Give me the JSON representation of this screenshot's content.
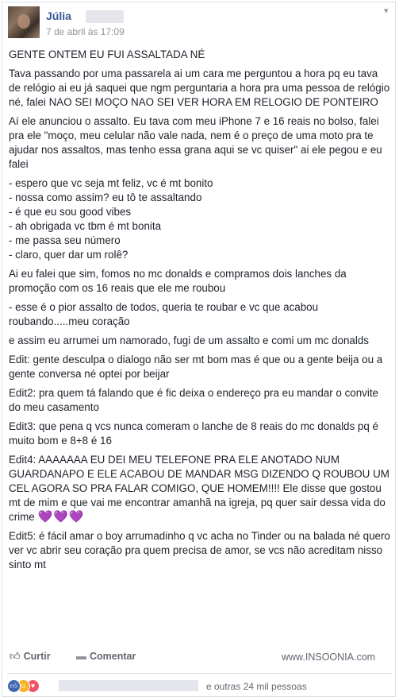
{
  "post": {
    "author": "Júlia",
    "timestamp": "7 de abril às 17:09",
    "paragraphs": {
      "p1": "GENTE ONTEM EU FUI ASSALTADA NÉ",
      "p2": "Tava passando por uma passarela ai um cara me perguntou a hora pq eu tava de relógio ai eu já saquei que ngm perguntaria a hora pra uma pessoa de relógio né, falei NAO SEI MOÇO NAO SEI VER HORA EM RELOGIO DE PONTEIRO",
      "p3": "Aí ele anunciou o assalto. Eu tava com meu iPhone 7 e 16 reais no bolso, falei pra ele \"moço, meu celular não vale nada, nem é o preço de uma moto pra te ajudar nos assaltos, mas tenho essa grana aqui se vc quiser\" ai ele pegou e eu falei",
      "dialogue": [
        "- espero que vc seja mt feliz, vc é mt bonito",
        "- nossa como assim? eu tô te assaltando",
        "- é que eu sou good vibes",
        "- ah obrigada vc tbm é mt bonita",
        "- me passa seu número",
        "- claro, quer dar um rolê?"
      ],
      "p4": "Ai eu falei que sim, fomos no mc donalds e compramos dois lanches da promoção com os 16 reais que ele me roubou",
      "p5": "- esse é o pior assalto de todos, queria te roubar e vc que acabou roubando.....meu coração",
      "p6": "e assim eu arrumei um namorado, fugi de um assalto e comi um mc donalds",
      "edit1": "Edit: gente desculpa o dialogo não ser mt bom mas é que ou a gente beija ou a gente conversa né optei por beijar",
      "edit2": "Edit2: pra quem tá falando que é fic deixa o endereço pra eu mandar o convite do meu casamento",
      "edit3": "Edit3: que pena q vcs nunca comeram o lanche de 8 reais do mc donalds pq é muito bom e 8+8 é 16",
      "edit4": "Edit4: AAAAAAA EU DEI MEU TELEFONE PRA ELE ANOTADO NUM GUARDANAPO E ELE ACABOU DE MANDAR MSG DIZENDO Q ROUBOU UM CEL AGORA SO PRA FALAR COMIGO, QUE HOMEM!!!! Ele disse que gostou mt de mim e que vai me encontrar amanhã na igreja, pq quer sair dessa vida do crime",
      "edit4_hearts": "💜💜💜",
      "edit5": "Edit5: é fácil amar o boy arrumadinho q vc acha no Tinder ou na balada né quero ver vc abrir seu coração pra quem precisa de amor, se vcs não acreditam nisso sinto mt"
    }
  },
  "actions": {
    "like_label": "Curtir",
    "comment_label": "Comentar",
    "like_icon": "thumbs-up-icon",
    "comment_icon": "speech-bubble-icon"
  },
  "watermark": "www.INSOONIA.com",
  "reactions": {
    "icons": [
      "like-reaction-icon",
      "haha-reaction-icon",
      "love-reaction-icon"
    ],
    "summary": "e outras 24 mil pessoas"
  },
  "colors": {
    "author": "#365899",
    "meta": "#90949c",
    "text": "#1d2129",
    "like": "#4267b2",
    "haha": "#f7b125",
    "love": "#f25268",
    "hearts": "#8b5fbf"
  }
}
